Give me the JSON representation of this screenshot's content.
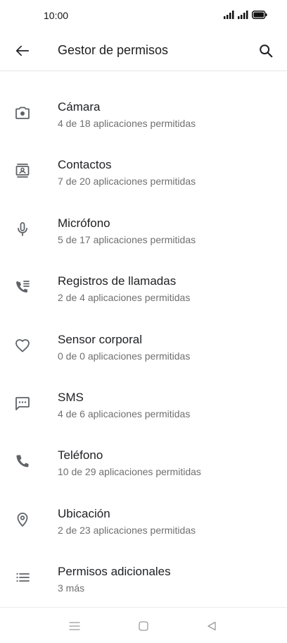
{
  "status_bar": {
    "time": "10:00",
    "icons": [
      "signal-icon",
      "signal-icon",
      "battery-icon"
    ]
  },
  "app_bar": {
    "title": "Gestor de permisos",
    "back_icon": "arrow-back-icon",
    "search_icon": "search-icon"
  },
  "permissions": [
    {
      "icon": "camera-icon",
      "title": "Cámara",
      "subtitle": "4 de 18 aplicaciones permitidas"
    },
    {
      "icon": "contacts-icon",
      "title": "Contactos",
      "subtitle": "7 de 20 aplicaciones permitidas"
    },
    {
      "icon": "microphone-icon",
      "title": "Micrófono",
      "subtitle": "5 de 17 aplicaciones permitidas"
    },
    {
      "icon": "call-log-icon",
      "title": "Registros de llamadas",
      "subtitle": "2 de 4 aplicaciones permitidas"
    },
    {
      "icon": "heart-icon",
      "title": "Sensor corporal",
      "subtitle": "0 de 0 aplicaciones permitidas"
    },
    {
      "icon": "sms-icon",
      "title": "SMS",
      "subtitle": "4 de 6 aplicaciones permitidas"
    },
    {
      "icon": "phone-icon",
      "title": "Teléfono",
      "subtitle": "10 de 29 aplicaciones permitidas"
    },
    {
      "icon": "location-icon",
      "title": "Ubicación",
      "subtitle": "2 de 23 aplicaciones permitidas"
    },
    {
      "icon": "list-icon",
      "title": "Permisos adicionales",
      "subtitle": "3 más"
    }
  ],
  "nav_bar": {
    "icons": [
      "menu-icon",
      "home-icon",
      "back-triangle-icon"
    ]
  },
  "colors": {
    "icon": "#5f6368",
    "title": "#202124",
    "subtitle": "#6f6f6f"
  }
}
